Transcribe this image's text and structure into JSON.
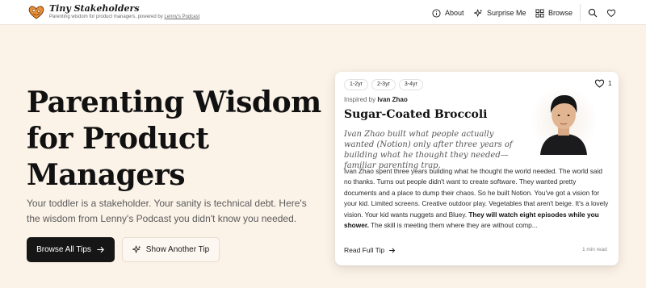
{
  "brand": {
    "title": "Tiny Stakeholders",
    "subtitle_prefix": "Parenting wisdom for product managers, powered by ",
    "subtitle_link": "Lenny's Podcast",
    "logo_icon": "heart-logo-icon"
  },
  "nav": {
    "about": "About",
    "surprise": "Surprise Me",
    "browse": "Browse",
    "search_icon": "search-icon",
    "favorites_icon": "heart-icon"
  },
  "hero": {
    "title_lines": [
      "Parenting Wisdom",
      "for Product",
      "Managers"
    ],
    "description": "Your toddler is a stakeholder. Your sanity is technical debt. Here's the wisdom from Lenny's Podcast you didn't know you needed.",
    "browse_button": "Browse All Tips",
    "another_button": "Show Another Tip"
  },
  "card": {
    "tags": [
      "1-2yr",
      "2-3yr",
      "3-4yr"
    ],
    "likes": "1",
    "inspired_prefix": "Inspired by ",
    "inspired_name": "Ivan Zhao",
    "title": "Sugar-Coated Broccoli",
    "quote": "Ivan Zhao built what people actually wanted (Notion) only after three years of building what he thought they needed—familiar parenting trap.",
    "body_plain": "Ivan Zhao spent three years building what he thought the world needed. The world said no thanks. Turns out people didn't want to create software. They wanted pretty documents and a place to dump their chaos. So he built Notion. You've got a vision for your kid. Limited screens. Creative outdoor play. Vegetables that aren't beige. It's a lovely vision. Your kid wants nuggets and Bluey. ",
    "body_bold": "They will watch eight episodes while you shower.",
    "body_tail": " The skill is meeting them where they are without comp...",
    "read_full": "Read Full Tip",
    "read_time": "1 min read"
  },
  "colors": {
    "background": "#fbf2e8",
    "header_bg": "#ffffff",
    "primary_button": "#161616",
    "logo_accent": "#e8913a"
  }
}
